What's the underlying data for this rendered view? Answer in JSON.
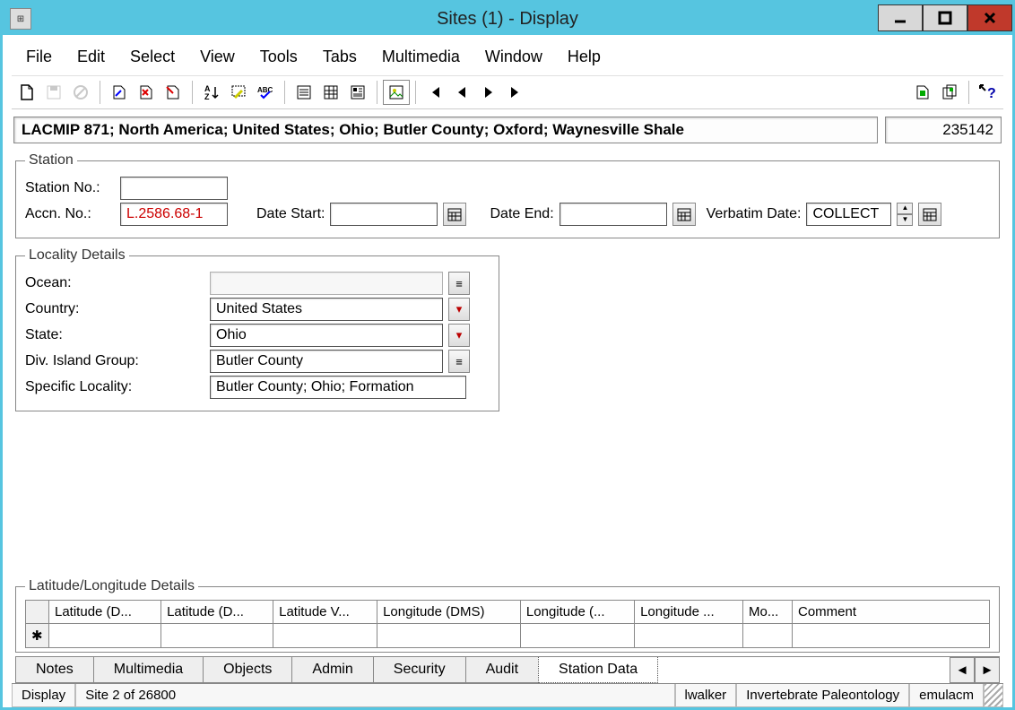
{
  "window": {
    "title": "Sites (1) - Display"
  },
  "menu": {
    "items": [
      "File",
      "Edit",
      "Select",
      "View",
      "Tools",
      "Tabs",
      "Multimedia",
      "Window",
      "Help"
    ]
  },
  "record": {
    "summary": "LACMIP 871; North America; United States; Ohio; Butler County; Oxford; Waynesville Shale",
    "id": "235142"
  },
  "station": {
    "legend": "Station",
    "station_no_label": "Station No.:",
    "station_no": "",
    "accn_no_label": "Accn. No.:",
    "accn_no": "L.2586.68-1",
    "date_start_label": "Date Start:",
    "date_start": "",
    "date_end_label": "Date End:",
    "date_end": "",
    "verbatim_label": "Verbatim Date:",
    "verbatim": "COLLECT"
  },
  "locality": {
    "legend": "Locality Details",
    "ocean_label": "Ocean:",
    "ocean": "",
    "country_label": "Country:",
    "country": "United States",
    "state_label": "State:",
    "state": "Ohio",
    "div_label": "Div. Island Group:",
    "div": "Butler County",
    "specific_label": "Specific Locality:",
    "specific": "Butler County; Ohio; Formation"
  },
  "latlon": {
    "legend": "Latitude/Longitude Details",
    "headers": [
      "Latitude (D...",
      "Latitude (D...",
      "Latitude V...",
      "Longitude (DMS)",
      "Longitude (...",
      "Longitude ...",
      "Mo...",
      "Comment"
    ]
  },
  "tabs": {
    "items": [
      "Notes",
      "Multimedia",
      "Objects",
      "Admin",
      "Security",
      "Audit",
      "Station Data"
    ],
    "active": "Station Data"
  },
  "status": {
    "mode": "Display",
    "position": "Site 2 of 26800",
    "user": "lwalker",
    "dept": "Invertebrate Paleontology",
    "host": "emulacm"
  }
}
